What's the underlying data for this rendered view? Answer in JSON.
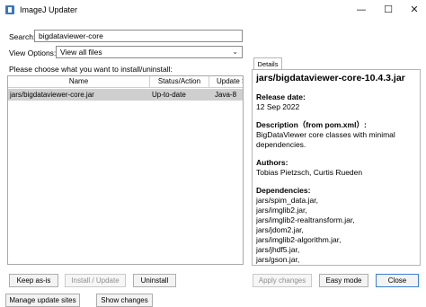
{
  "window": {
    "title": "ImageJ Updater",
    "controls": [
      "—",
      "☐",
      "✕"
    ]
  },
  "search": {
    "label": "Search:",
    "value": "bigdataviewer-core"
  },
  "view_options": {
    "label": "View Options:",
    "selected": "View all files"
  },
  "list_prompt": "Please choose what you want to install/uninstall:",
  "table": {
    "columns": [
      "Name",
      "Status/Action",
      "Update Site"
    ],
    "rows": [
      {
        "name": "jars/bigdataviewer-core.jar",
        "status": "Up-to-date",
        "site": "Java-8"
      }
    ]
  },
  "details": {
    "tab": "Details",
    "title": "jars/bigdataviewer-core-10.4.3.jar",
    "release_label": "Release date:",
    "release_value": "12 Sep 2022",
    "description_label": "Description（from pom.xml）:",
    "description_value": "BigDataViewer core classes with minimal dependencies.",
    "authors_label": "Authors:",
    "authors_value": "Tobias Pietzsch, Curtis Rueden",
    "dependencies_label": "Dependencies:",
    "dependencies": [
      "jars/spim_data.jar,",
      "jars/imglib2.jar,",
      "jars/imglib2-realtransform.jar,",
      "jars/jdom2.jar,",
      "jars/imglib2-algorithm.jar,",
      "jars/jhdf5.jar,",
      "jars/gson.jar,"
    ]
  },
  "buttons": {
    "keep": "Keep as-is",
    "install": "Install / Update",
    "uninstall": "Uninstall",
    "apply": "Apply changes",
    "easy": "Easy mode",
    "close": "Close",
    "manage": "Manage update sites",
    "show": "Show changes"
  }
}
